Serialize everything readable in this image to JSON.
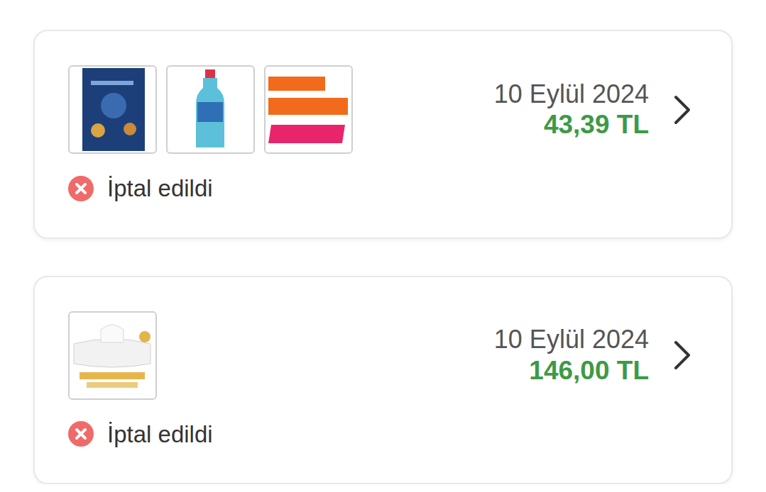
{
  "orders": [
    {
      "date": "10 Eylül 2024",
      "price": "43,39 TL",
      "status": "İptal edildi",
      "cancelled": true,
      "items": [
        {
          "kind": "book"
        },
        {
          "kind": "bottle"
        },
        {
          "kind": "promo"
        }
      ]
    },
    {
      "date": "10 Eylül 2024",
      "price": "146,00 TL",
      "status": "İptal edildi",
      "cancelled": true,
      "items": [
        {
          "kind": "wipes"
        }
      ]
    }
  ]
}
